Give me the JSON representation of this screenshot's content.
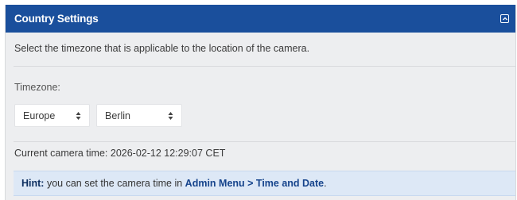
{
  "panel": {
    "title": "Country Settings",
    "collapse_icon": "collapse-square-icon",
    "header_color": "#1a4f9c"
  },
  "description": "Select the timezone that is applicable to the location of the camera.",
  "timezone": {
    "label": "Timezone:",
    "region_selected": "Europe",
    "city_selected": "Berlin",
    "select_icon": "up-down-arrows-icon"
  },
  "camera_time": "Current camera time: 2026-02-12 12:29:07 CET",
  "hint": {
    "label": "Hint:",
    "text": "you can set the camera time in",
    "link_text": "Admin Menu > Time and Date",
    "suffix": "."
  }
}
